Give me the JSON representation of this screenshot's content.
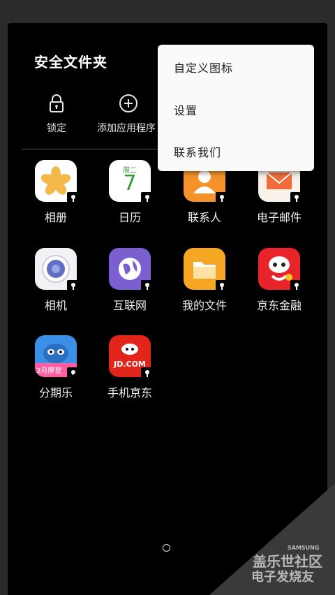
{
  "header": {
    "title": "安全文件夹"
  },
  "actions": {
    "lock_label": "锁定",
    "add_apps_label": "添加应用程序"
  },
  "menu": {
    "items": [
      "自定义图标",
      "设置",
      "联系我们"
    ]
  },
  "apps": [
    {
      "label": "相册"
    },
    {
      "label": "日历",
      "calendar_weekday": "周二",
      "calendar_day": "7"
    },
    {
      "label": "联系人"
    },
    {
      "label": "电子邮件"
    },
    {
      "label": "相机"
    },
    {
      "label": "互联网"
    },
    {
      "label": "我的文件"
    },
    {
      "label": "京东金融"
    },
    {
      "label": "分期乐",
      "icon_text": "3月摩登"
    },
    {
      "label": "手机京东",
      "icon_text": "JD.COM"
    }
  ],
  "watermark": {
    "line1": "盖乐世社区",
    "line2": "电子发烧友",
    "brand": "SAMSUNG"
  }
}
